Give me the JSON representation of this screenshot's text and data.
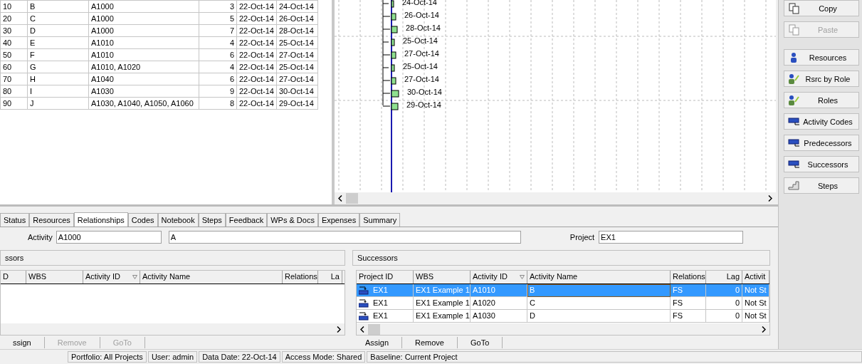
{
  "activities": {
    "rows": [
      {
        "id": "10",
        "name": "B",
        "predecessors": "A1000",
        "duration": "3",
        "start": "22-Oct-14",
        "finish": "24-Oct-14"
      },
      {
        "id": "20",
        "name": "C",
        "predecessors": "A1000",
        "duration": "5",
        "start": "22-Oct-14",
        "finish": "26-Oct-14"
      },
      {
        "id": "30",
        "name": "D",
        "predecessors": "A1000",
        "duration": "7",
        "start": "22-Oct-14",
        "finish": "28-Oct-14"
      },
      {
        "id": "40",
        "name": "E",
        "predecessors": "A1010",
        "duration": "4",
        "start": "22-Oct-14",
        "finish": "25-Oct-14"
      },
      {
        "id": "50",
        "name": "F",
        "predecessors": "A1010",
        "duration": "6",
        "start": "22-Oct-14",
        "finish": "27-Oct-14"
      },
      {
        "id": "60",
        "name": "G",
        "predecessors": "A1010, A1020",
        "duration": "4",
        "start": "22-Oct-14",
        "finish": "25-Oct-14"
      },
      {
        "id": "70",
        "name": "H",
        "predecessors": "A1040",
        "duration": "6",
        "start": "22-Oct-14",
        "finish": "27-Oct-14"
      },
      {
        "id": "80",
        "name": "I",
        "predecessors": "A1030",
        "duration": "9",
        "start": "22-Oct-14",
        "finish": "30-Oct-14"
      },
      {
        "id": "90",
        "name": "J",
        "predecessors": "A1030, A1040, A1050, A1060",
        "duration": "8",
        "start": "22-Oct-14",
        "finish": "29-Oct-14"
      }
    ]
  },
  "gantt": {
    "bar_labels": [
      "24-Oct-14",
      "26-Oct-14",
      "28-Oct-14",
      "25-Oct-14",
      "27-Oct-14",
      "25-Oct-14",
      "27-Oct-14",
      "30-Oct-14",
      "29-Oct-14"
    ]
  },
  "toolbar": [
    {
      "label": "Copy",
      "kind": "document",
      "disabled": false
    },
    {
      "label": "Paste",
      "kind": "document",
      "disabled": true
    },
    {
      "label": "Resources",
      "kind": "person",
      "disabled": false
    },
    {
      "label": "Rsrc by Role",
      "kind": "role",
      "disabled": false
    },
    {
      "label": "Roles",
      "kind": "role",
      "disabled": false
    },
    {
      "label": "Activity Codes",
      "kind": "bar",
      "disabled": false
    },
    {
      "label": "Predecessors",
      "kind": "bar",
      "disabled": false
    },
    {
      "label": "Successors",
      "kind": "bar",
      "disabled": false
    },
    {
      "label": "Steps",
      "kind": "steps",
      "disabled": false
    }
  ],
  "tabs": [
    {
      "label": "Status",
      "selected": false
    },
    {
      "label": "Resources",
      "selected": false
    },
    {
      "label": "Relationships",
      "selected": true
    },
    {
      "label": "Codes",
      "selected": false
    },
    {
      "label": "Notebook",
      "selected": false
    },
    {
      "label": "Steps",
      "selected": false
    },
    {
      "label": "Feedback",
      "selected": false
    },
    {
      "label": "WPs & Docs",
      "selected": false
    },
    {
      "label": "Expenses",
      "selected": false
    },
    {
      "label": "Summary",
      "selected": false
    }
  ],
  "form": {
    "activity_label": "Activity",
    "activity_id": "A1000",
    "activity_name": "A",
    "project_label": "Project",
    "project_id": "EX1"
  },
  "predecessors": {
    "title": "ssors",
    "columns": [
      "D",
      "WBS",
      "Activity ID",
      "Activity Name",
      "Relations",
      "La"
    ],
    "buttons": [
      {
        "label": "ssign",
        "disabled": false
      },
      {
        "label": "Remove",
        "disabled": true
      },
      {
        "label": "GoTo",
        "disabled": true
      }
    ]
  },
  "successors": {
    "title": "Successors",
    "columns": [
      "Project ID",
      "WBS",
      "Activity ID",
      "Activity Name",
      "Relations",
      "Lag",
      "Activit"
    ],
    "rows": [
      {
        "project": "EX1",
        "wbs": "EX1 Example 1",
        "activity_id": "A1010",
        "name": "B",
        "relation": "FS",
        "lag": "0",
        "status": "Not St",
        "selected": true
      },
      {
        "project": "EX1",
        "wbs": "EX1 Example 1",
        "activity_id": "A1020",
        "name": "C",
        "relation": "FS",
        "lag": "0",
        "status": "Not St",
        "selected": false
      },
      {
        "project": "EX1",
        "wbs": "EX1 Example 1",
        "activity_id": "A1030",
        "name": "D",
        "relation": "FS",
        "lag": "0",
        "status": "Not St",
        "selected": false
      }
    ],
    "buttons": [
      {
        "label": "Assign",
        "disabled": false
      },
      {
        "label": "Remove",
        "disabled": false
      },
      {
        "label": "GoTo",
        "disabled": false
      }
    ]
  },
  "status_bar": [
    "Portfolio: All Projects",
    "User: admin",
    "Data Date: 22-Oct-14",
    "Access Mode: Shared",
    "Baseline: Current Project"
  ]
}
